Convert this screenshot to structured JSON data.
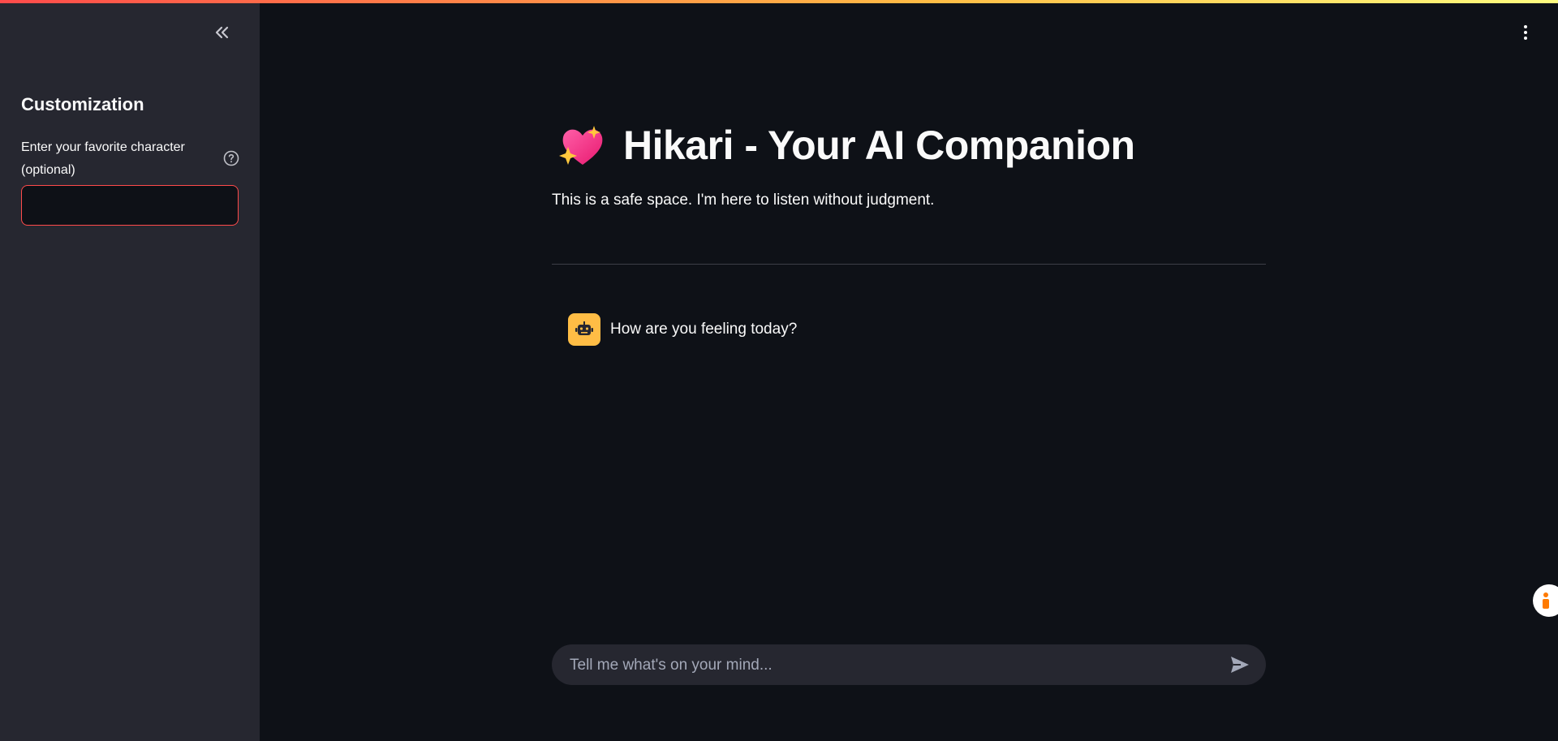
{
  "sidebar": {
    "title": "Customization",
    "field_label": "Enter your favorite character (optional)",
    "field_value": "",
    "icons": {
      "collapse": "double-chevron-left-icon",
      "help": "question-circle-icon"
    }
  },
  "header": {
    "title_emoji": "💖",
    "title": "Hikari - Your AI Companion",
    "subtitle": "This is a safe space. I'm here to listen without judgment."
  },
  "chat": {
    "messages": [
      {
        "role": "assistant",
        "avatar_icon": "robot-icon",
        "text": "How are you feeling today?"
      }
    ],
    "input_placeholder": "Tell me what's on your mind...",
    "send_icon": "send-icon"
  },
  "colors": {
    "accent": "#ff4b4b",
    "avatar_bg": "#ffbd45",
    "sidebar_bg": "#262730",
    "main_bg": "#0e1117"
  }
}
